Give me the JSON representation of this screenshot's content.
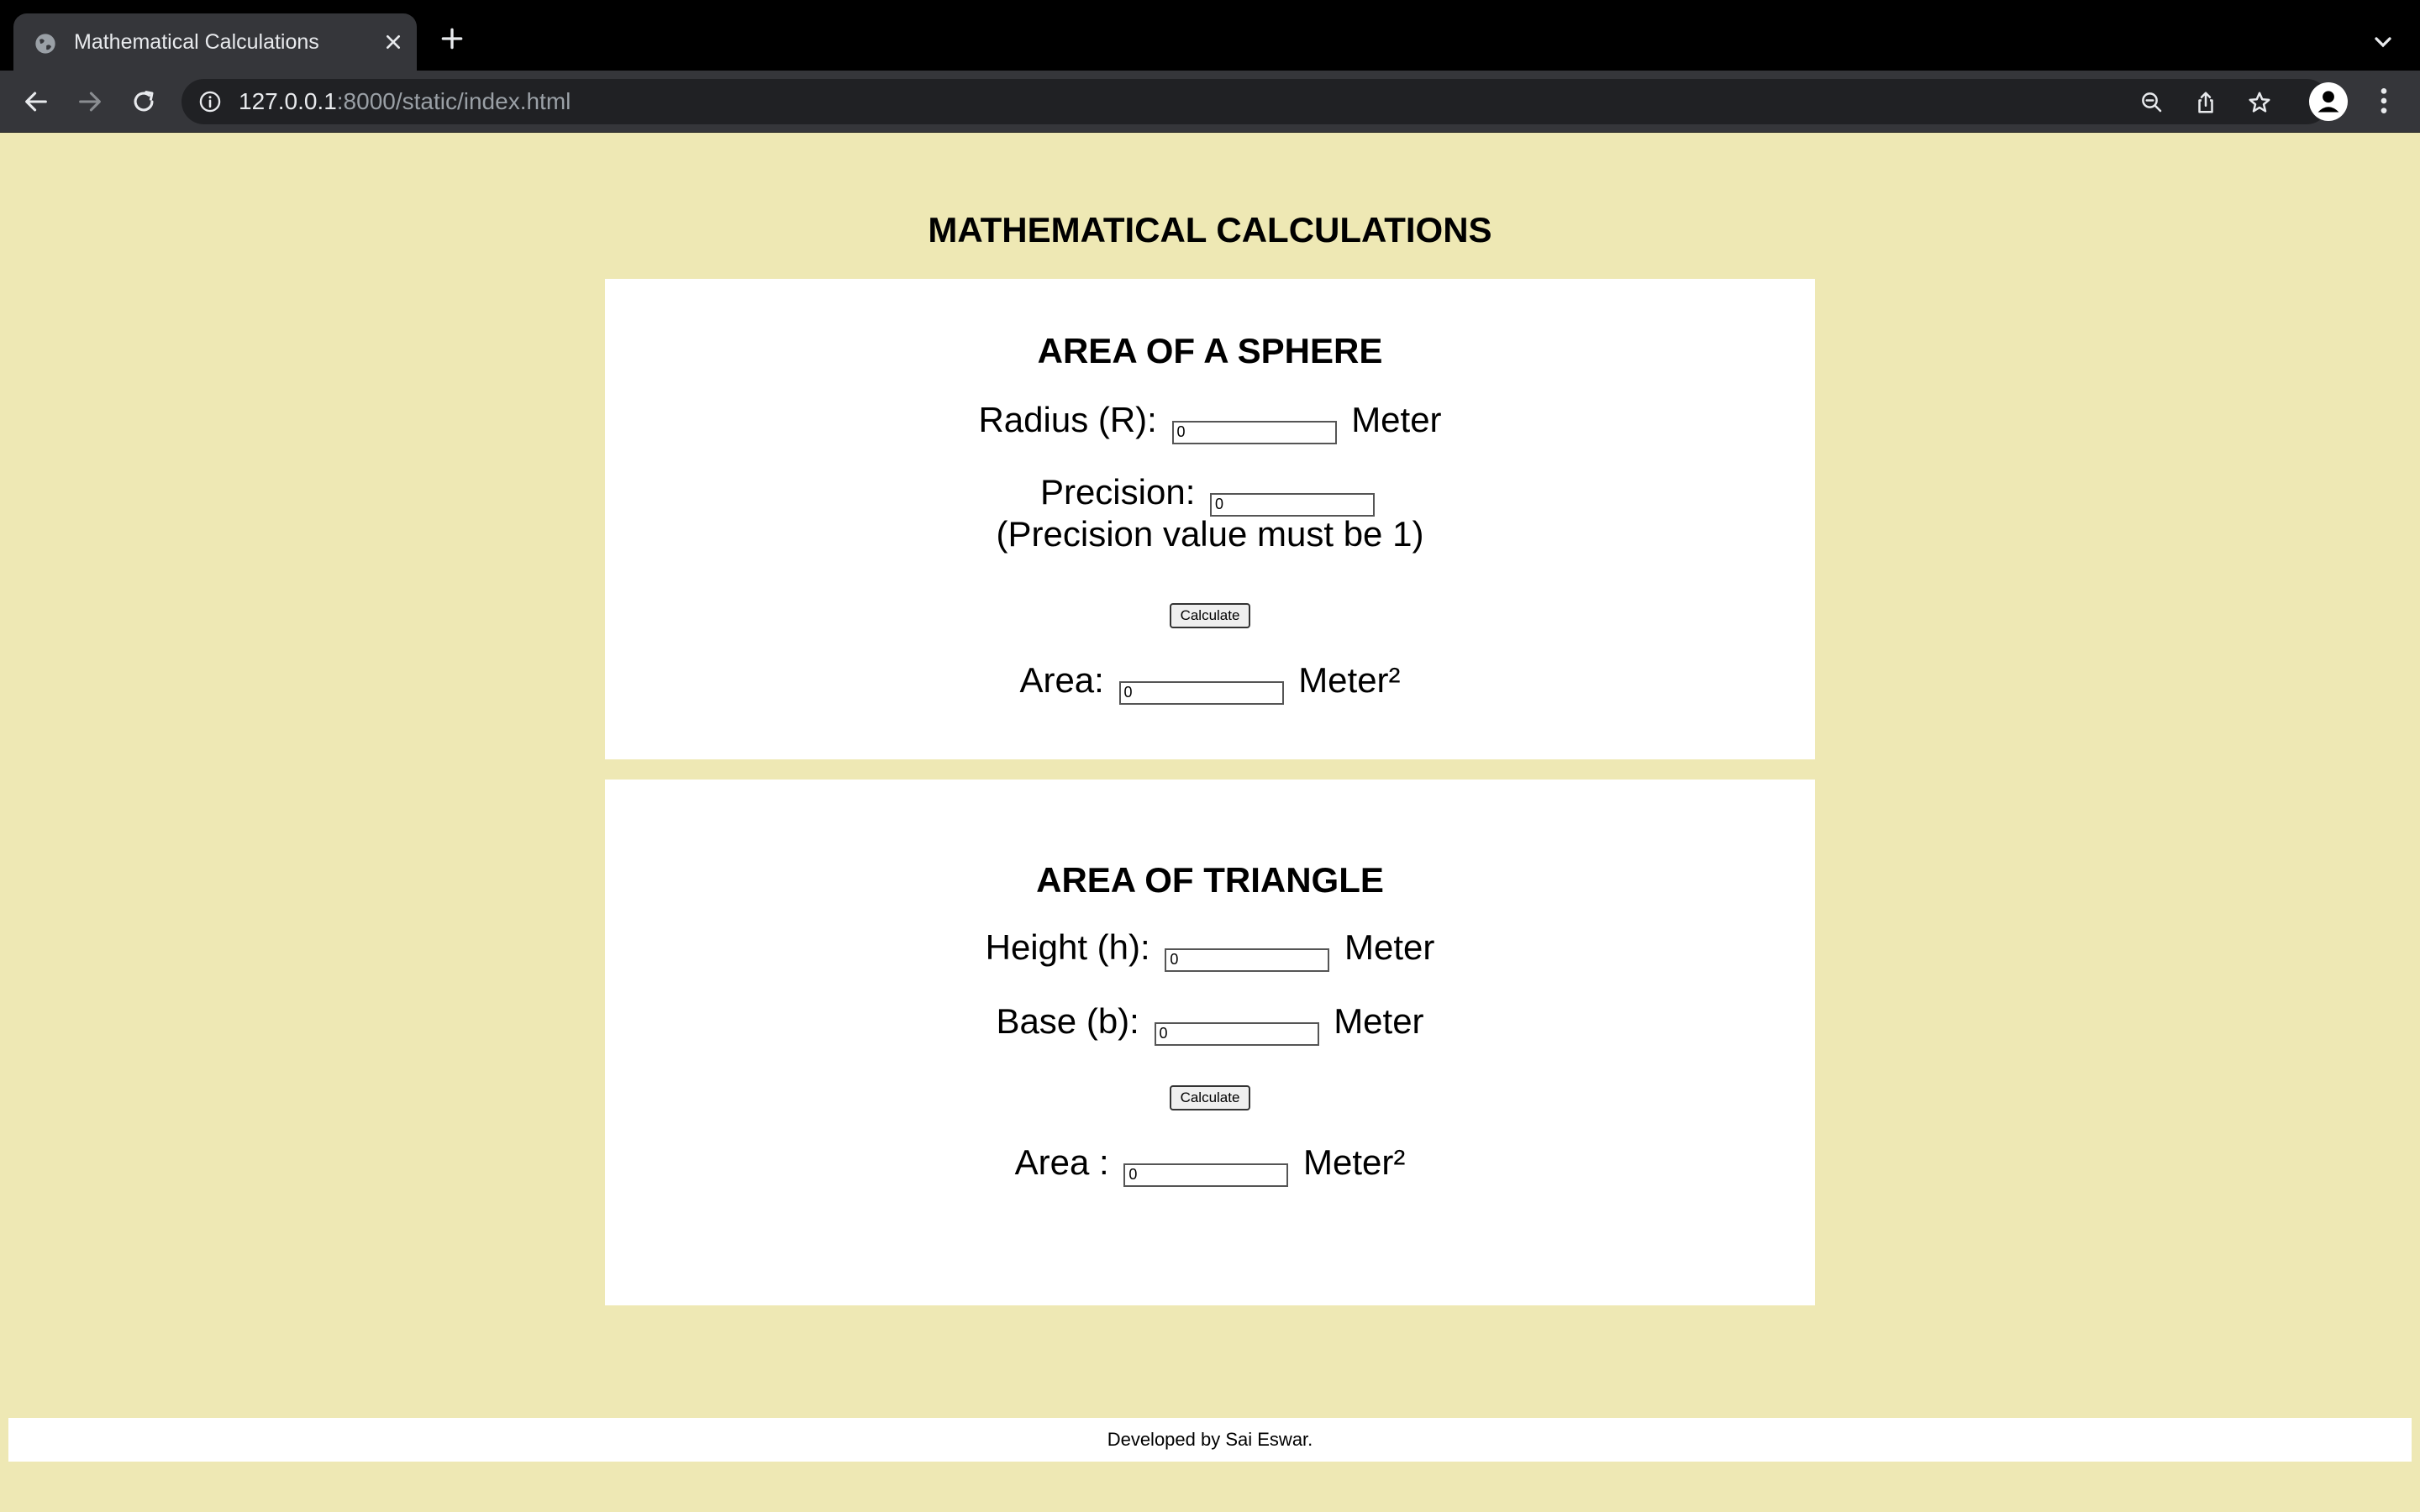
{
  "browser": {
    "tab_title": "Mathematical Calculations",
    "url_host": "127.0.0.1",
    "url_rest": ":8000/static/index.html"
  },
  "page": {
    "title": "MATHEMATICAL CALCULATIONS",
    "background_color": "#eee8b4"
  },
  "sphere": {
    "title": "AREA OF A SPHERE",
    "radius_label": "Radius (R):",
    "radius_value": "0",
    "radius_unit": "Meter",
    "precision_label": "Precision:",
    "precision_value": "0",
    "precision_note": "(Precision value must be 1)",
    "calculate_label": "Calculate",
    "area_label": "Area:",
    "area_value": "0",
    "area_unit": "Meter²"
  },
  "triangle": {
    "title": "AREA OF TRIANGLE",
    "height_label": "Height (h):",
    "height_value": "0",
    "height_unit": "Meter",
    "base_label": "Base (b):",
    "base_value": "0",
    "base_unit": "Meter",
    "calculate_label": "Calculate",
    "area_label": "Area :",
    "area_value": "0",
    "area_unit": "Meter²"
  },
  "footer": {
    "text": "Developed by Sai Eswar."
  }
}
